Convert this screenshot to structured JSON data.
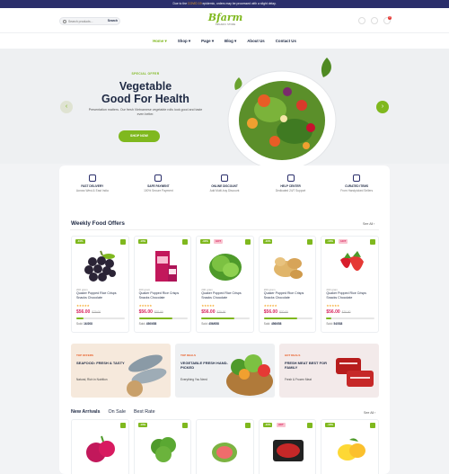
{
  "topbar": {
    "text_before": "Due to the ",
    "highlight": "COVID 19",
    "text_after": " epidemic, orders may be processed with a slight delay."
  },
  "header": {
    "search_placeholder": "Search products...",
    "search_button": "Search",
    "logo_word": "Bfarm",
    "logo_sub": "ORGANIC STORE",
    "cart_count": "0",
    "wish_count": "0"
  },
  "nav": {
    "items": [
      "Home ▾",
      "Shop ▾",
      "Page ▾",
      "Blog ▾",
      "About Us",
      "Contact Us"
    ]
  },
  "hero": {
    "special": "SPECIAL OFFER",
    "title_line1": "Vegetable",
    "title_line2": "Good For Health",
    "desc": "Presentation matters. Our fresh Vietnamese vegetable rolls look good and taste even better.",
    "button": "SHOP NOW",
    "prev": "‹",
    "next": "›"
  },
  "features": [
    {
      "title": "FAST DELIVERY",
      "sub": "Across West & East India"
    },
    {
      "title": "SAFE PAYMENT",
      "sub": "100% Secure Payment"
    },
    {
      "title": "ONLINE DISCOUNT",
      "sub": "Add Multi-buy Discount"
    },
    {
      "title": "HELP CENTER",
      "sub": "Dedicated 24/7 Support"
    },
    {
      "title": "CURATED ITEMS",
      "sub": "From Handpicked Sellers"
    }
  ],
  "weekly": {
    "title": "Weekly Food Offers",
    "see_all": "See All ›",
    "products": [
      {
        "badge": "-10%",
        "hot": "",
        "weight": "200 gram",
        "name": "Quaker Popped Rice Crisps Snacks Chocolate",
        "stars": "★★★★★",
        "price": "$56.00",
        "old": "$70.00",
        "sold_label": "Sold:",
        "sold": "16/208",
        "progress": 0.15
      },
      {
        "badge": "-10%",
        "hot": "",
        "weight": "200 gram",
        "name": "Quaker Popped Rice Crisps Snacks Chocolate",
        "stars": "★★★★★",
        "price": "$56.00",
        "old": "$70.00",
        "sold_label": "Sold:",
        "sold": "456/658",
        "progress": 0.69
      },
      {
        "badge": "-10%",
        "hot": "HOT",
        "weight": "200 gram",
        "name": "Quaker Popped Rice Crisps Snacks Chocolate",
        "stars": "★★★★★",
        "price": "$56.00",
        "old": "$70.00",
        "sold_label": "Sold:",
        "sold": "456/658",
        "progress": 0.69
      },
      {
        "badge": "-10%",
        "hot": "",
        "weight": "200 gram",
        "name": "Quaker Popped Rice Crisps Snacks Chocolate",
        "stars": "★★★★★",
        "price": "$56.00",
        "old": "$70.00",
        "sold_label": "Sold:",
        "sold": "456/658",
        "progress": 0.69
      },
      {
        "badge": "-10%",
        "hot": "HOT",
        "weight": "200 gram",
        "name": "Quaker Popped Rice Crisps Snacks Chocolate",
        "stars": "★★★★★",
        "price": "$56.00",
        "old": "$70.00",
        "sold_label": "Sold:",
        "sold": "54/538",
        "progress": 0.1
      }
    ]
  },
  "banners": [
    {
      "tag": "TOP OFFERS",
      "title": "SEAFOOD: FRESH & TASTY",
      "sub": "Natural, Rich in Nutrition",
      "color": "#f6e9dc"
    },
    {
      "tag": "TOP DEALS",
      "title": "VEGETABLE FRESH HAND-PICKED",
      "sub": "Everything You Need",
      "color": "#eef0f2"
    },
    {
      "tag": "HOT DEALS",
      "title": "FRESH MEAT BEST FOR FAMILY",
      "sub": "Fresh & Frozen Meat",
      "color": "#f3eaea"
    }
  ],
  "arrivals": {
    "tabs": [
      "New Arrivals",
      "On Sale",
      "Best Rate"
    ],
    "see_all": "See All ›",
    "badges": [
      "",
      "-10%",
      "",
      "-10%",
      "-10%"
    ],
    "hot": [
      "",
      "",
      "",
      "HOT",
      ""
    ]
  },
  "colors": {
    "accent": "#7fb81e",
    "navy": "#2b2f6b",
    "price": "#d8265f"
  }
}
